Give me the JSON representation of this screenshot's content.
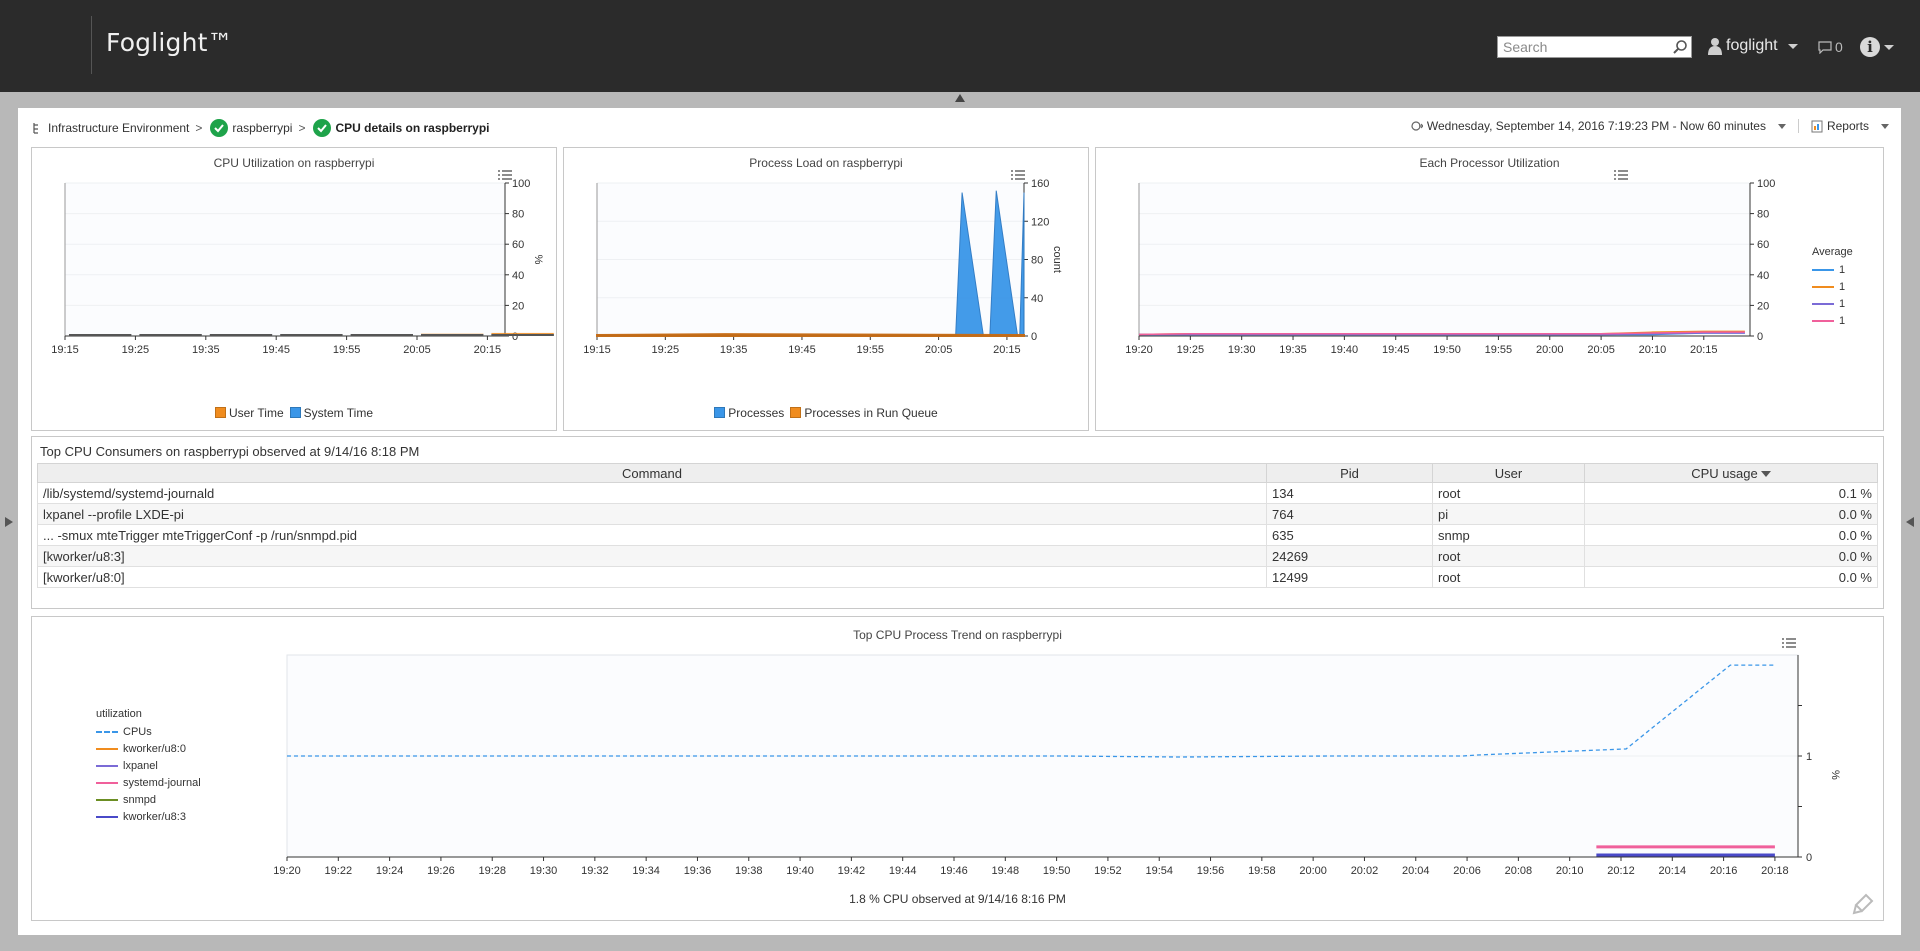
{
  "header": {
    "brand": "Foglight™",
    "search_placeholder": "Search",
    "user": "foglight",
    "messages": "0"
  },
  "breadcrumb": {
    "items": [
      "Infrastructure Environment",
      "raspberrypi",
      "CPU details on raspberrypi"
    ]
  },
  "timebar": {
    "range": "Wednesday, September 14, 2016 7:19:23 PM - Now 60 minutes",
    "reports": "Reports"
  },
  "charts": {
    "cpu": {
      "title": "CPU Utilization on raspberrypi",
      "legend": [
        "User Time",
        "System Time"
      ],
      "colors": [
        "#f08c1e",
        "#3a96e8"
      ]
    },
    "load": {
      "title": "Process Load on raspberrypi",
      "legend": [
        "Processes",
        "Processes in Run Queue"
      ],
      "colors": [
        "#3a96e8",
        "#f08c1e"
      ]
    },
    "proc": {
      "title": "Each Processor Utilization",
      "legend_title": "Average",
      "legend": [
        "1",
        "1",
        "1",
        "1"
      ],
      "colors": [
        "#3a96e8",
        "#f08c1e",
        "#7b6bd6",
        "#f0609b"
      ]
    },
    "trend": {
      "title": "Top CPU Process Trend on raspberrypi",
      "legend_title": "utilization",
      "legend": [
        "CPUs",
        "kworker/u8:0",
        "lxpanel",
        "systemd-journal",
        "snmpd",
        "kworker/u8:3"
      ],
      "colors": [
        "#3a96e8",
        "#f08c1e",
        "#7b6bd6",
        "#f0609b",
        "#6b8e23",
        "#4a4ac8"
      ],
      "footer": "1.8 % CPU observed at 9/14/16 8:16 PM"
    }
  },
  "table": {
    "title": "Top CPU Consumers on raspberrypi observed at 9/14/16 8:18 PM",
    "headers": [
      "Command",
      "Pid",
      "User",
      "CPU usage"
    ],
    "rows": [
      [
        "/lib/systemd/systemd-journald",
        "134",
        "root",
        "0.1 %"
      ],
      [
        "lxpanel --profile LXDE-pi",
        "764",
        "pi",
        "0.0 %"
      ],
      [
        "... -smux mteTrigger mteTriggerConf -p /run/snmpd.pid",
        "635",
        "snmp",
        "0.0 %"
      ],
      [
        "[kworker/u8:3]",
        "24269",
        "root",
        "0.0 %"
      ],
      [
        "[kworker/u8:0]",
        "12499",
        "root",
        "0.0 %"
      ]
    ]
  },
  "chart_data": [
    {
      "type": "area",
      "title": "CPU Utilization on raspberrypi",
      "x": [
        "19:15",
        "19:25",
        "19:35",
        "19:45",
        "19:55",
        "20:05",
        "20:15"
      ],
      "ylabel": "%",
      "ylim": [
        0,
        100
      ],
      "yticks": [
        0,
        20,
        40,
        60,
        80,
        100
      ],
      "series": [
        {
          "name": "User Time",
          "values": [
            0.5,
            0.5,
            0.5,
            0.5,
            0.5,
            1.5,
            2
          ]
        },
        {
          "name": "System Time",
          "values": [
            0.5,
            0.5,
            0.5,
            0.5,
            0.5,
            0.5,
            1
          ]
        }
      ]
    },
    {
      "type": "area",
      "title": "Process Load on raspberrypi",
      "x": [
        "19:15",
        "19:25",
        "19:35",
        "19:45",
        "19:55",
        "20:05",
        "20:15"
      ],
      "ylabel": "count",
      "ylim": [
        0,
        160
      ],
      "yticks": [
        0,
        40,
        80,
        120,
        160
      ],
      "series": [
        {
          "name": "Processes",
          "points": [
            [
              0,
              1
            ],
            [
              0.84,
              1
            ],
            [
              0.855,
              150
            ],
            [
              0.905,
              0
            ],
            [
              0.92,
              0
            ],
            [
              0.935,
              152
            ],
            [
              0.985,
              0
            ],
            [
              0.99,
              0
            ],
            [
              1.0,
              150
            ]
          ]
        },
        {
          "name": "Processes in Run Queue",
          "points": [
            [
              0,
              1
            ],
            [
              0.3,
              2
            ],
            [
              1.0,
              1
            ]
          ]
        }
      ]
    },
    {
      "type": "line",
      "title": "Each Processor Utilization",
      "x": [
        "19:20",
        "19:25",
        "19:30",
        "19:35",
        "19:40",
        "19:45",
        "19:50",
        "19:55",
        "20:00",
        "20:05",
        "20:10",
        "20:15"
      ],
      "ylabel": "%",
      "ylim": [
        0,
        100
      ],
      "yticks": [
        0,
        20,
        40,
        60,
        80,
        100
      ],
      "series": [
        {
          "name": "1",
          "values": [
            1,
            1,
            1,
            1,
            1,
            1,
            1,
            1,
            1,
            1,
            1,
            2
          ]
        },
        {
          "name": "1",
          "values": [
            1,
            1.5,
            1.5,
            1.5,
            1.5,
            1.5,
            1.5,
            1.5,
            1.5,
            1.5,
            2.5,
            3
          ]
        },
        {
          "name": "1",
          "values": [
            1,
            1,
            1,
            1,
            1,
            1,
            1,
            1,
            1,
            1,
            1.5,
            2
          ]
        },
        {
          "name": "1",
          "values": [
            1,
            1.5,
            1.5,
            1.5,
            1.5,
            1.5,
            1.5,
            1.5,
            1.5,
            1.5,
            2,
            2.5
          ]
        }
      ]
    },
    {
      "type": "line",
      "title": "Top CPU Process Trend on raspberrypi",
      "x": [
        "19:20",
        "19:22",
        "19:24",
        "19:26",
        "19:28",
        "19:30",
        "19:32",
        "19:34",
        "19:36",
        "19:38",
        "19:40",
        "19:42",
        "19:44",
        "19:46",
        "19:48",
        "19:50",
        "19:52",
        "19:54",
        "19:56",
        "19:58",
        "20:00",
        "20:02",
        "20:04",
        "20:06",
        "20:08",
        "20:10",
        "20:12",
        "20:14",
        "20:16",
        "20:18"
      ],
      "ylabel": "%",
      "yticks": [
        0,
        1
      ],
      "series": [
        {
          "name": "CPUs",
          "points": [
            [
              0,
              1.0
            ],
            [
              0.1,
              1.0
            ],
            [
              0.2,
              1.0
            ],
            [
              0.3,
              1.0
            ],
            [
              0.45,
              1.0
            ],
            [
              0.52,
              1.0
            ],
            [
              0.6,
              0.99
            ],
            [
              0.7,
              1.0
            ],
            [
              0.79,
              1.0
            ],
            [
              0.8,
              1.01
            ],
            [
              0.9,
              1.07
            ],
            [
              0.97,
              1.9
            ],
            [
              1.0,
              1.9
            ]
          ]
        },
        {
          "name": "systemd-journal",
          "points": [
            [
              0.88,
              0.1
            ],
            [
              1.0,
              0.1
            ]
          ]
        },
        {
          "name": "kworker/u8:3",
          "points": [
            [
              0.88,
              0.02
            ],
            [
              1.0,
              0.02
            ]
          ]
        }
      ],
      "footer": "1.8 % CPU observed at 9/14/16 8:16 PM"
    }
  ]
}
